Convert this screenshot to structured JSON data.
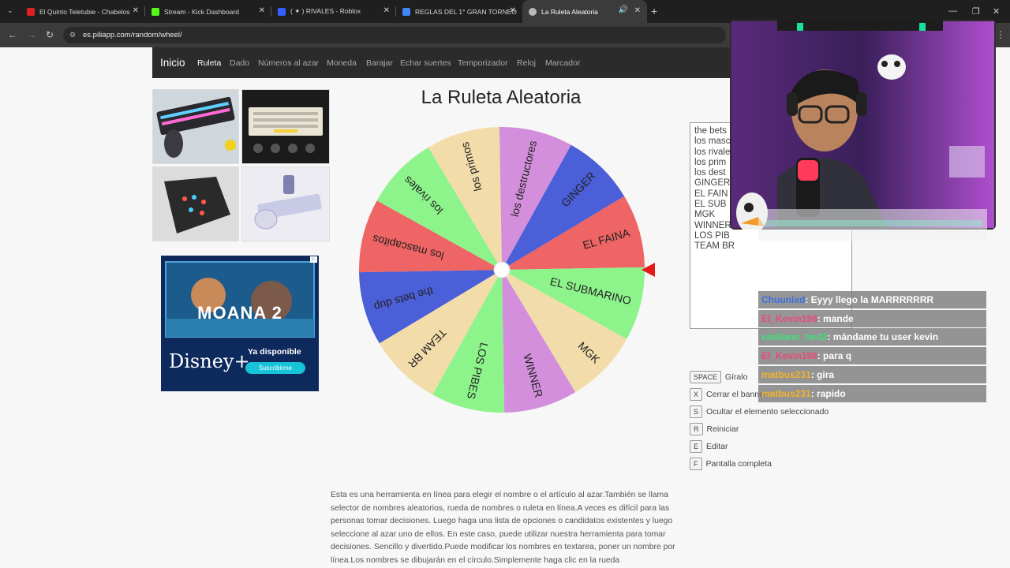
{
  "browser": {
    "tabs": [
      {
        "title": "El Quinto Teletubie - Chabelos",
        "favicon_color": "#e02020"
      },
      {
        "title": "Stream - Kick Dashboard",
        "favicon_color": "#53fc18"
      },
      {
        "title": "( ✦ ) RIVALES - Roblox",
        "favicon_color": "#335fff"
      },
      {
        "title": "REGLAS DEL 1° GRAN TORNEO",
        "favicon_color": "#4285f4"
      },
      {
        "title": "La Ruleta Aleatoria",
        "favicon_color": "#b9b9b9"
      }
    ],
    "url": "es.piliapp.com/random/wheel/"
  },
  "site_nav": {
    "brand": "Inicio",
    "links": [
      "Ruleta",
      "Dado",
      "Números al azar",
      "Moneda",
      "Barajar",
      "Echar suertes",
      "Temporizador",
      "Reloj",
      "Marcador"
    ]
  },
  "ad": {
    "top_text": "MOANA 2",
    "brand": "Disney+",
    "tagline": "Ya disponible",
    "button": "Suscribirme"
  },
  "page": {
    "title": "La Ruleta Aleatoria"
  },
  "wheel": {
    "segments": [
      {
        "label": "los destructores",
        "color": "#d48fdc"
      },
      {
        "label": "GINGER",
        "color": "#4b5fd8"
      },
      {
        "label": "EL FAINA",
        "color": "#ef6464"
      },
      {
        "label": "EL SUBMARINO",
        "color": "#8df48b"
      },
      {
        "label": "MGK",
        "color": "#f1dcaa"
      },
      {
        "label": "WINNER",
        "color": "#d48fdc"
      },
      {
        "label": "LOS PIBES",
        "color": "#8df48b"
      },
      {
        "label": "TEAM BR",
        "color": "#f1dcaa"
      },
      {
        "label": "the bets dup",
        "color": "#4b5fd8"
      },
      {
        "label": "los mascapitos",
        "color": "#ef6464"
      },
      {
        "label": "los rivales",
        "color": "#8df48b"
      },
      {
        "label": "los primos",
        "color": "#f1dcaa"
      }
    ],
    "pointer_color": "#e81818"
  },
  "names_list": [
    "the bets",
    "los masc",
    "los rivale",
    "los prim",
    "los dest",
    "GINGER",
    "EL FAIN",
    "EL SUB",
    "MGK",
    "WINNER",
    "LOS PIB",
    "TEAM BR"
  ],
  "shortcuts": [
    {
      "key": "SPACE",
      "label": "Gíralo"
    },
    {
      "key": "X",
      "label": "Cerrar el banner"
    },
    {
      "key": "S",
      "label": "Ocultar el elemento seleccionado"
    },
    {
      "key": "R",
      "label": "Reiniciar"
    },
    {
      "key": "E",
      "label": "Editar"
    },
    {
      "key": "F",
      "label": "Pantalla completa"
    }
  ],
  "description": "Esta es una herramienta en línea para elegir el nombre o el artículo al azar.También se llama selector de nombres aleatorios, rueda de nombres o ruleta en línea.A veces es difícil para las personas tomar decisiones. Luego haga una lista de opciones o candidatos existentes y luego seleccione al azar uno de ellos. En este caso, puede utilizar nuestra herramienta para tomar decisiones. Sencillo y divertido.Puede modificar los nombres en textarea, poner un nombre por línea.Los nombres se dibujarán en el círculo.Simplemente haga clic en la rueda",
  "chat": [
    {
      "user": "Chuunixd",
      "user_color": "#3a6fe0",
      "message": ": Eyyy llego la MARRRRRRR"
    },
    {
      "user": "El_Kevin198",
      "user_color": "#e84b7a",
      "message": ": mande"
    },
    {
      "user": "emiliano_hed2",
      "user_color": "#3fe07a",
      "message": ": mándame tu user kevin"
    },
    {
      "user": "El_Kevin198",
      "user_color": "#e84b7a",
      "message": ": para q"
    },
    {
      "user": "matbus231",
      "user_color": "#f0b429",
      "message": ": gira"
    },
    {
      "user": "matbus231",
      "user_color": "#f0b429",
      "message": ": rapido"
    }
  ]
}
